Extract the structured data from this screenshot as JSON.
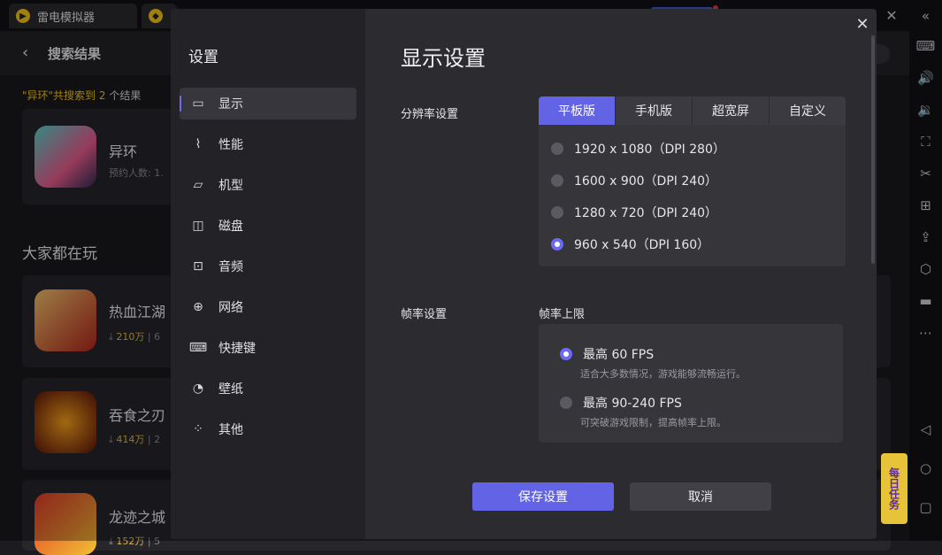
{
  "titlebar": {
    "tabs": [
      {
        "label": "雷电模拟器"
      },
      {
        "label": ""
      }
    ]
  },
  "background": {
    "header_title": "搜索结果",
    "result_prefix": "\"异环\"共搜索到",
    "result_count": "2",
    "result_suffix": "个结果",
    "top_card": {
      "name": "异环",
      "sub": "预约人数: 1."
    },
    "section_title": "大家都在玩",
    "games": [
      {
        "name": "热血江湖",
        "downloads": "210万",
        "extra": "6"
      },
      {
        "name": "吞食之刃",
        "downloads": "414万",
        "extra": "2"
      },
      {
        "name": "龙迹之城",
        "downloads": "152万",
        "extra": "5"
      }
    ]
  },
  "dialog": {
    "sidebar_title": "设置",
    "nav": [
      {
        "label": "显示",
        "icon": "display-icon",
        "active": true
      },
      {
        "label": "性能",
        "icon": "performance-icon"
      },
      {
        "label": "机型",
        "icon": "device-model-icon"
      },
      {
        "label": "磁盘",
        "icon": "disk-icon"
      },
      {
        "label": "音频",
        "icon": "audio-icon"
      },
      {
        "label": "网络",
        "icon": "network-icon"
      },
      {
        "label": "快捷键",
        "icon": "keyboard-icon"
      },
      {
        "label": "壁纸",
        "icon": "wallpaper-icon"
      },
      {
        "label": "其他",
        "icon": "other-icon"
      }
    ],
    "title": "显示设置",
    "resolution": {
      "label": "分辨率设置",
      "tabs": [
        "平板版",
        "手机版",
        "超宽屏",
        "自定义"
      ],
      "selected_tab": "平板版",
      "options": [
        "1920 x 1080（DPI 280）",
        "1600 x 900（DPI 240）",
        "1280 x 720（DPI 240）",
        "960 x 540（DPI 160）"
      ],
      "selected_option": "960 x 540（DPI 160）"
    },
    "framerate": {
      "label": "帧率设置",
      "sub_label": "帧率上限",
      "options": [
        {
          "title": "最高 60 FPS",
          "desc": "适合大多数情况，游戏能够流畅运行。",
          "selected": true
        },
        {
          "title": "最高 90-240 FPS",
          "desc": "可突破游戏限制，提高帧率上限。",
          "selected": false
        }
      ]
    },
    "save_label": "保存设置",
    "cancel_label": "取消"
  },
  "sticker": "每日任务",
  "accent_color": "#6363e6"
}
